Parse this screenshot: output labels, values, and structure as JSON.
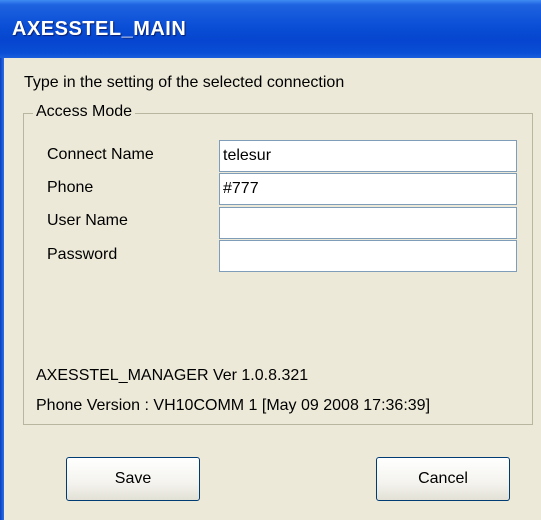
{
  "window": {
    "title": "AXESSTEL_MAIN"
  },
  "instruction": "Type in the setting of the selected connection",
  "group": {
    "legend": "Access Mode",
    "fields": {
      "connect_name": {
        "label": "Connect Name",
        "value": "telesur"
      },
      "phone": {
        "label": "Phone",
        "value": "#777"
      },
      "user_name": {
        "label": "User Name",
        "value": ""
      },
      "password": {
        "label": "Password",
        "value": ""
      }
    },
    "manager_version": "AXESSTEL_MANAGER Ver 1.0.8.321",
    "phone_version": "Phone Version : VH10COMM  1  [May 09 2008 17:36:39]"
  },
  "buttons": {
    "save_label": "Save",
    "cancel_label": "Cancel"
  }
}
